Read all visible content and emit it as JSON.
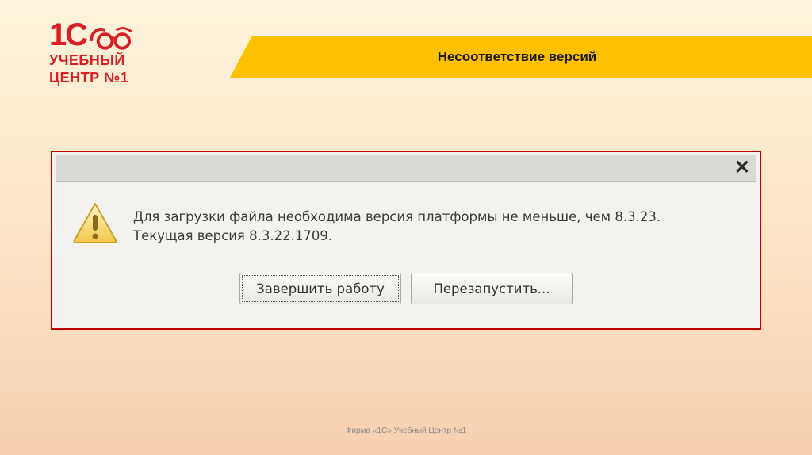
{
  "logo": {
    "mark": "1С",
    "line1": "УЧЕБНЫЙ",
    "line2": "ЦЕНТР №1",
    "color": "#d91f26"
  },
  "slide": {
    "title": "Несоответствие версий",
    "band_color": "#ffc000",
    "footer": "Фирма «1С» Учебный Центр №1"
  },
  "dialog": {
    "close_icon": "close-icon",
    "warning_icon": "warning-triangle-icon",
    "message_line1": "Для загрузки файла необходима версия платформы не меньше, чем 8.3.23.",
    "message_line2": "Текущая версия 8.3.22.1709.",
    "buttons": {
      "exit": "Завершить работу",
      "restart": "Перезапустить..."
    },
    "frame_color": "#c00000"
  }
}
